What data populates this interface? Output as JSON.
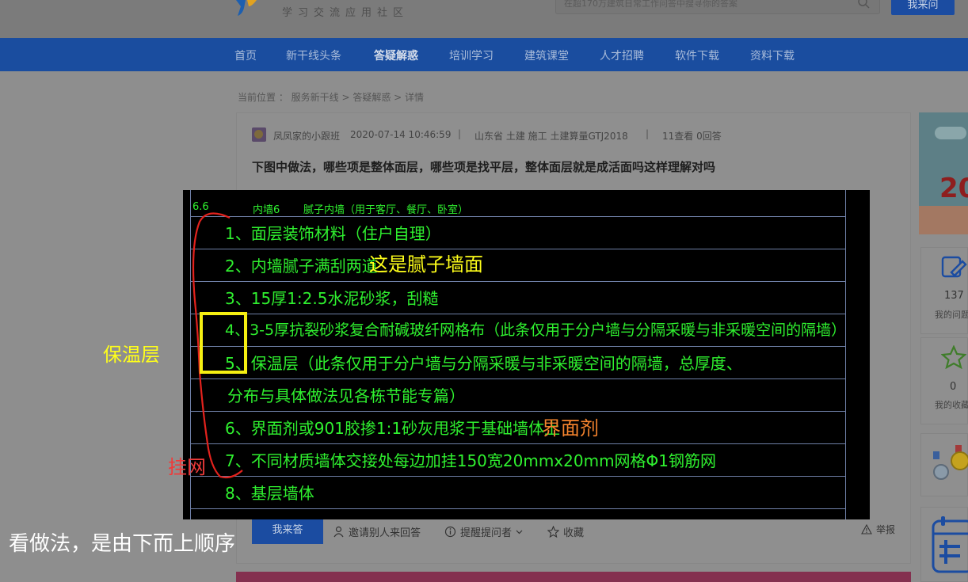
{
  "header": {
    "logo_subtitle": "学习交流应用社区",
    "search_placeholder": "在超170万建筑日常工作问答中搜寻你的答案",
    "ask_button": "我来问"
  },
  "nav": {
    "items": [
      "首页",
      "新干线头条",
      "答疑解惑",
      "培训学习",
      "建筑课堂",
      "人才招聘",
      "软件下载",
      "资料下载"
    ],
    "active_index": 2
  },
  "breadcrumb": "当前位置 ： 服务新干线 > 答疑解惑 > 详情",
  "question": {
    "author": "凤凤家的小跟班",
    "datetime": "2020-07-14 10:46:59",
    "sep": "|",
    "tags": "山东省  土建 施工 土建算量GTJ2018",
    "stats": "11查看 0回答",
    "title": "下图中做法，哪些项是整体面层，哪些项是找平层，整体面层就是成活面吗这样理解对吗"
  },
  "cad": {
    "header_code": "6.6",
    "header_name": "内墙6",
    "header_desc": "腻子内墙（用于客厅、餐厅、卧室）",
    "rows": [
      "1、面层装饰材料（住户自理）",
      "2、内墙腻子满刮两道",
      "3、15厚1:2.5水泥砂浆，刮糙",
      "4、3-5厚抗裂砂浆复合耐碱玻纤网格布（此条仅用于分户墙与分隔采暖与非采暖空间的隔墙）",
      "5、保温层（此条仅用于分户墙与分隔采暖与非采暖空间的隔墙，总厚度、",
      "分布与具体做法见各栋节能专篇）",
      "6、界面剂或901胶掺1:1砂灰甩浆于基础墙体上",
      "7、不同材质墙体交接处每边加挂150宽20mmx20mm网格Φ1钢筋网",
      "8、基层墙体"
    ]
  },
  "annotations": {
    "putty": "这是腻子墙面",
    "insulation": "保温层",
    "interface": "界面剂",
    "mesh": "挂网",
    "order_note": "看做法，是由下而上顺序"
  },
  "actions": {
    "answer": "我来答",
    "invite": "邀请别人来回答",
    "remind": "提醒提问者",
    "favorite": "收藏",
    "report": "举报"
  },
  "right_rail": {
    "banner_text": "20",
    "questions_count": "137",
    "questions_label": "我的问题",
    "favorites_count": "0",
    "favorites_label": "我的收藏"
  },
  "colors": {
    "brand_blue": "#1b4ca1",
    "cad_text": "#2ff02f",
    "annotation_yellow": "#ffff1a",
    "annotation_orange": "#f6842e",
    "annotation_red": "#f03a3a"
  }
}
